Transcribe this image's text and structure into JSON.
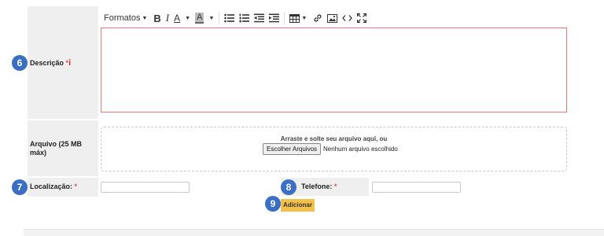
{
  "toolbar": {
    "formats_label": "Formatos",
    "buttons": [
      "bold-icon",
      "italic-icon",
      "font-color-icon",
      "background-color-icon",
      "bullet-list-icon",
      "numbered-list-icon",
      "outdent-icon",
      "indent-icon",
      "table-icon",
      "link-icon",
      "image-icon",
      "source-code-icon",
      "fullscreen-icon"
    ]
  },
  "steps": {
    "description": "6",
    "location": "7",
    "phone": "8",
    "add": "9"
  },
  "description": {
    "label": "Descrição",
    "required_mark": "*",
    "info_mark": "i",
    "value": ""
  },
  "attachment": {
    "label": "Arquivo (25 MB máx)",
    "drop_hint": "Arraste e solte seu arquivo aqui, ou",
    "choose_button": "Escolher Arquivos",
    "status": "Nenhum arquivo escolhido"
  },
  "location": {
    "label": "Localização:",
    "required_mark": "*",
    "value": ""
  },
  "phone": {
    "label": "Telefone:",
    "required_mark": "*",
    "value": ""
  },
  "add_button": "Adicionar",
  "colors": {
    "badge": "#3b6fc4",
    "required": "#d9534f",
    "error_border": "#e47a7a",
    "add_button": "#f5c04a",
    "label_bg": "#efefef"
  }
}
